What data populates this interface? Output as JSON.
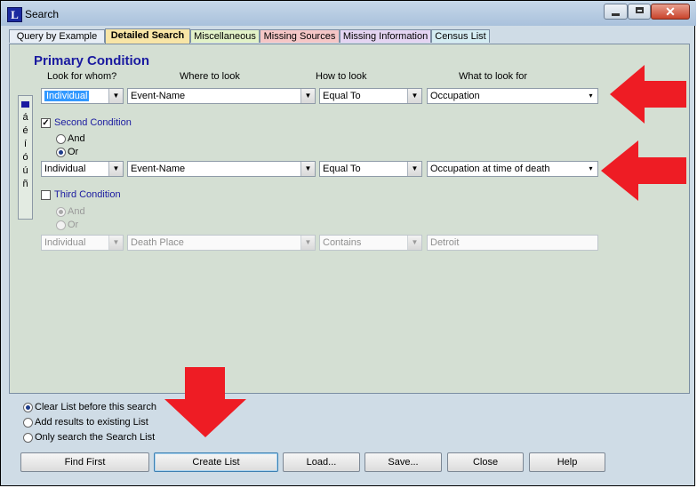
{
  "window": {
    "title": "Search",
    "app_icon_letter": "L",
    "close_glyph": "✕"
  },
  "tabs": [
    {
      "label": "Query by Example"
    },
    {
      "label": "Detailed Search"
    },
    {
      "label": "Miscellaneous"
    },
    {
      "label": "Missing Sources"
    },
    {
      "label": "Missing Information"
    },
    {
      "label": "Census List"
    }
  ],
  "panel": {
    "heading": "Primary Condition",
    "columns": {
      "who": "Look for whom?",
      "where": "Where to look",
      "how": "How to look",
      "what": "What to look for"
    }
  },
  "conditions": {
    "primary": {
      "who": "Individual",
      "where": "Event-Name",
      "how": "Equal To",
      "what": "Occupation"
    },
    "second": {
      "label": "Second Condition",
      "checked": true,
      "and_label": "And",
      "or_label": "Or",
      "who": "Individual",
      "where": "Event-Name",
      "how": "Equal To",
      "what": "Occupation at time of death"
    },
    "third": {
      "label": "Third Condition",
      "checked": false,
      "and_label": "And",
      "or_label": "Or",
      "who": "Individual",
      "where": "Death Place",
      "how": "Contains",
      "what": "Detroit"
    }
  },
  "special_chars": [
    "á",
    "é",
    "í",
    "ó",
    "ú",
    "ñ"
  ],
  "list_options": [
    {
      "label": "Clear List before this search",
      "selected": true
    },
    {
      "label": "Add results to existing List",
      "selected": false
    },
    {
      "label": "Only search the Search List",
      "selected": false
    }
  ],
  "buttons": {
    "find_first": "Find First",
    "create_list": "Create List",
    "load": "Load...",
    "save": "Save...",
    "close": "Close",
    "help": "Help"
  },
  "colors": {
    "annotation_arrow": "#ee1c24",
    "heading": "#1a1aa0",
    "active_tab": "#f8e5a6"
  }
}
